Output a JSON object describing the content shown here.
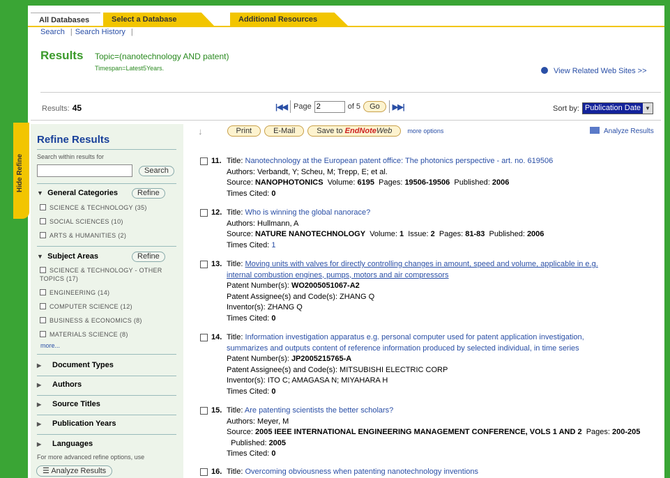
{
  "tabs": {
    "all": "All Databases",
    "select": "Select a Database",
    "additional": "Additional Resources"
  },
  "sublinks": {
    "search": "Search",
    "history": "Search History"
  },
  "header": {
    "title": "Results",
    "topic": "Topic=(nanotechnology AND patent)",
    "timespan": "Timespan=Latest5Years.",
    "related": "View Related Web Sites >>"
  },
  "summary": {
    "results_label": "Results:",
    "results_count": "45",
    "page_label": "Page",
    "page_value": "2",
    "of_label": "of 5",
    "go": "Go",
    "sort_label": "Sort by:",
    "sort_value": "Publication Date"
  },
  "hide_refine": "Hide Refine",
  "refine": {
    "title": "Refine Results",
    "search_within": "Search within results for",
    "search_button": "Search",
    "refine_button": "Refine",
    "general": {
      "label": "General Categories",
      "items": [
        "SCIENCE & TECHNOLOGY (35)",
        "SOCIAL SCIENCES (10)",
        "ARTS & HUMANITIES (2)"
      ]
    },
    "subject": {
      "label": "Subject Areas",
      "items": [
        "SCIENCE & TECHNOLOGY - OTHER TOPICS (17)",
        "ENGINEERING (14)",
        "COMPUTER SCIENCE (12)",
        "BUSINESS & ECONOMICS (8)",
        "MATERIALS SCIENCE (8)"
      ]
    },
    "more": "more...",
    "collapsed": [
      "Document Types",
      "Authors",
      "Source Titles",
      "Publication Years",
      "Languages"
    ],
    "advanced_note": "For more advanced refine options, use",
    "analyze_button": "Analyze Results"
  },
  "toolbar": {
    "print": "Print",
    "email": "E-Mail",
    "save_prefix": "Save to ",
    "save_endnote": "EndNote",
    "save_web": "Web",
    "more_options": "more options",
    "analyze": "Analyze Results"
  },
  "records": [
    {
      "num": "11.",
      "title": "Nanotechnology at the European patent office: The photonics perspective - art. no. 619506",
      "authors": "Verbandt, Y; Scheu, M; Trepp, E; et al.",
      "source": "NANOPHOTONICS",
      "volume": "6195",
      "pages": "19506-19506",
      "published": "2006",
      "cited": "0"
    },
    {
      "num": "12.",
      "title": "Who is winning the global nanorace?",
      "authors": "Hullmann, A",
      "source": "NATURE NANOTECHNOLOGY",
      "volume": "1",
      "issue": "2",
      "pages": "81-83",
      "published": "2006",
      "cited": "1"
    },
    {
      "num": "13.",
      "title1": "Moving units with valves for directly controlling changes in amount, speed and volume, applicable in e.g.",
      "title2": "internal combustion engines, pumps, motors and air compressors",
      "patent_number": "WO2005051067-A2",
      "assignee": "ZHANG Q",
      "inventor": "ZHANG Q",
      "cited": "0"
    },
    {
      "num": "14.",
      "title1": "Information investigation apparatus e.g. personal computer used for patent application investigation,",
      "title2": "summarizes and outputs content of reference information produced by selected individual, in time series",
      "patent_number": "JP2005215765-A",
      "assignee": "MITSUBISHI ELECTRIC CORP",
      "inventor": "ITO C; AMAGASA N; MIYAHARA H",
      "cited": "0"
    },
    {
      "num": "15.",
      "title": "Are patenting scientists the better scholars?",
      "authors": "Meyer, M",
      "source": "2005 IEEE INTERNATIONAL ENGINEERING MANAGEMENT CONFERENCE, VOLS 1 AND 2",
      "pages": "200-205",
      "published": "2005",
      "cited": "0"
    },
    {
      "num": "16.",
      "title": "Overcoming obviousness when patenting nanotechnology inventions"
    }
  ],
  "labels": {
    "title": "Title:",
    "authors": "Authors:",
    "source": "Source:",
    "volume": "Volume:",
    "issue": "Issue:",
    "pages": "Pages:",
    "published": "Published:",
    "cited": "Times Cited:",
    "patent_number": "Patent Number(s):",
    "assignee": "Patent Assignee(s) and Code(s):",
    "inventor": "Inventor(s):"
  }
}
